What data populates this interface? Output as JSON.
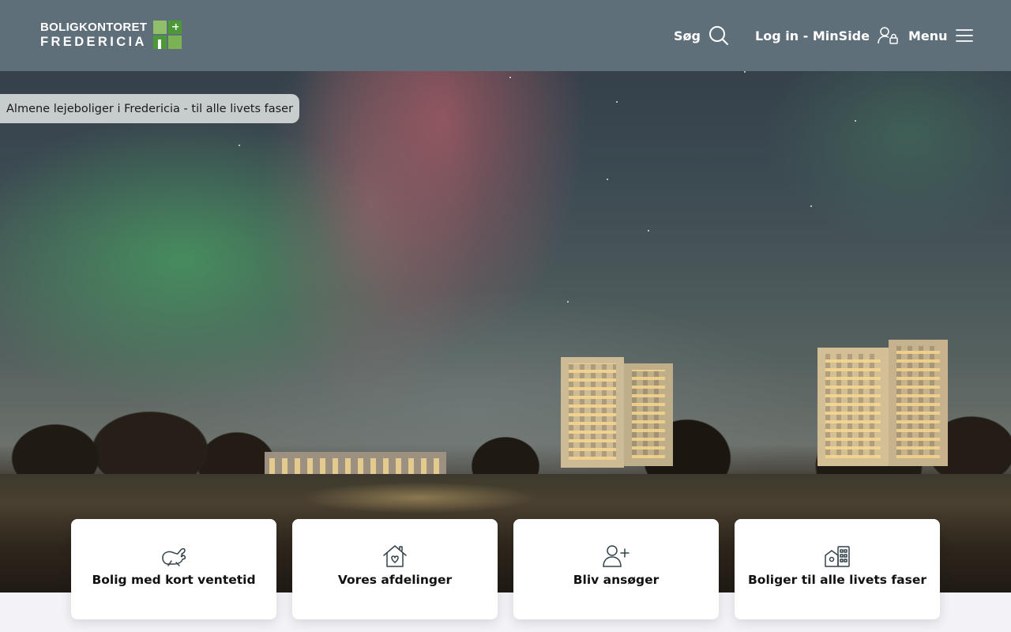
{
  "header": {
    "logo": {
      "line1": "BOLIGKONTORET",
      "line2": "FREDERICIA"
    },
    "search_label": "Søg",
    "login_label": "Log in - MinSide",
    "menu_label": "Menu"
  },
  "hero": {
    "tagline": "Almene lejeboliger i Fredericia - til alle livets faser"
  },
  "cards": [
    {
      "label": "Bolig med kort ventetid",
      "icon": "rabbit-icon"
    },
    {
      "label": "Vores afdelinger",
      "icon": "house-heart-icon"
    },
    {
      "label": "Bliv ansøger",
      "icon": "user-plus-icon"
    },
    {
      "label": "Boliger til alle livets faser",
      "icon": "buildings-icon"
    }
  ],
  "colors": {
    "header_bg": "#5e6f79",
    "logo_green": "#4c9a37",
    "card_bg": "#ffffff",
    "page_bg": "#f3f2f6"
  }
}
